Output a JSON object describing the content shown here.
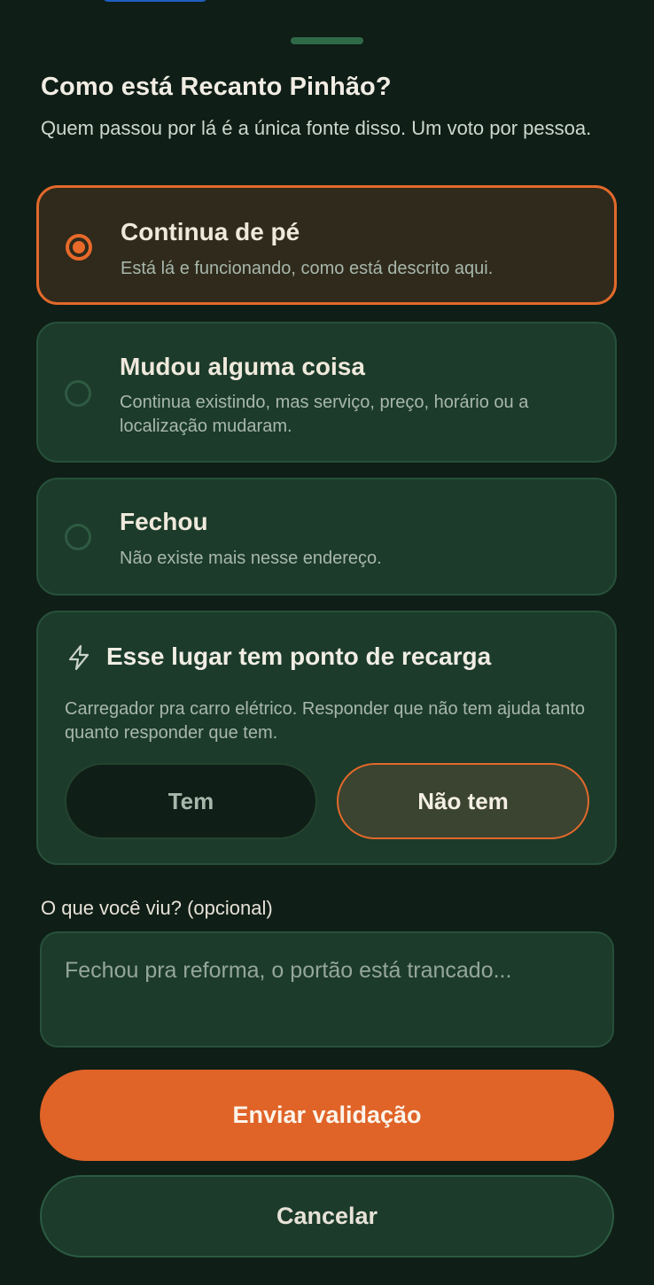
{
  "sheet": {
    "title": "Como está Recanto Pinhão?",
    "subtitle": "Quem passou por lá é a única fonte disso. Um voto por pessoa."
  },
  "options": [
    {
      "title": "Continua de pé",
      "description": "Está lá e funcionando, como está descrito aqui.",
      "selected": true
    },
    {
      "title": "Mudou alguma coisa",
      "description": "Continua existindo, mas serviço, preço, horário ou a localização mudaram.",
      "selected": false
    },
    {
      "title": "Fechou",
      "description": "Não existe mais nesse endereço.",
      "selected": false
    }
  ],
  "charging": {
    "icon": "lightning-bolt-icon",
    "title": "Esse lugar tem ponto de recarga",
    "description": "Carregador pra carro elétrico. Responder que não tem ajuda tanto quanto responder que tem.",
    "yes_label": "Tem",
    "no_label": "Não tem",
    "selected": "no"
  },
  "notes": {
    "label": "O que você viu? (opcional)",
    "placeholder": "Fechou pra reforma, o portão está trancado...",
    "value": ""
  },
  "actions": {
    "submit_label": "Enviar validação",
    "cancel_label": "Cancelar"
  },
  "colors": {
    "background": "#0f1e16",
    "card": "#1c3b2a",
    "accent": "#e06328",
    "selected_card": "#2f2a1b"
  }
}
